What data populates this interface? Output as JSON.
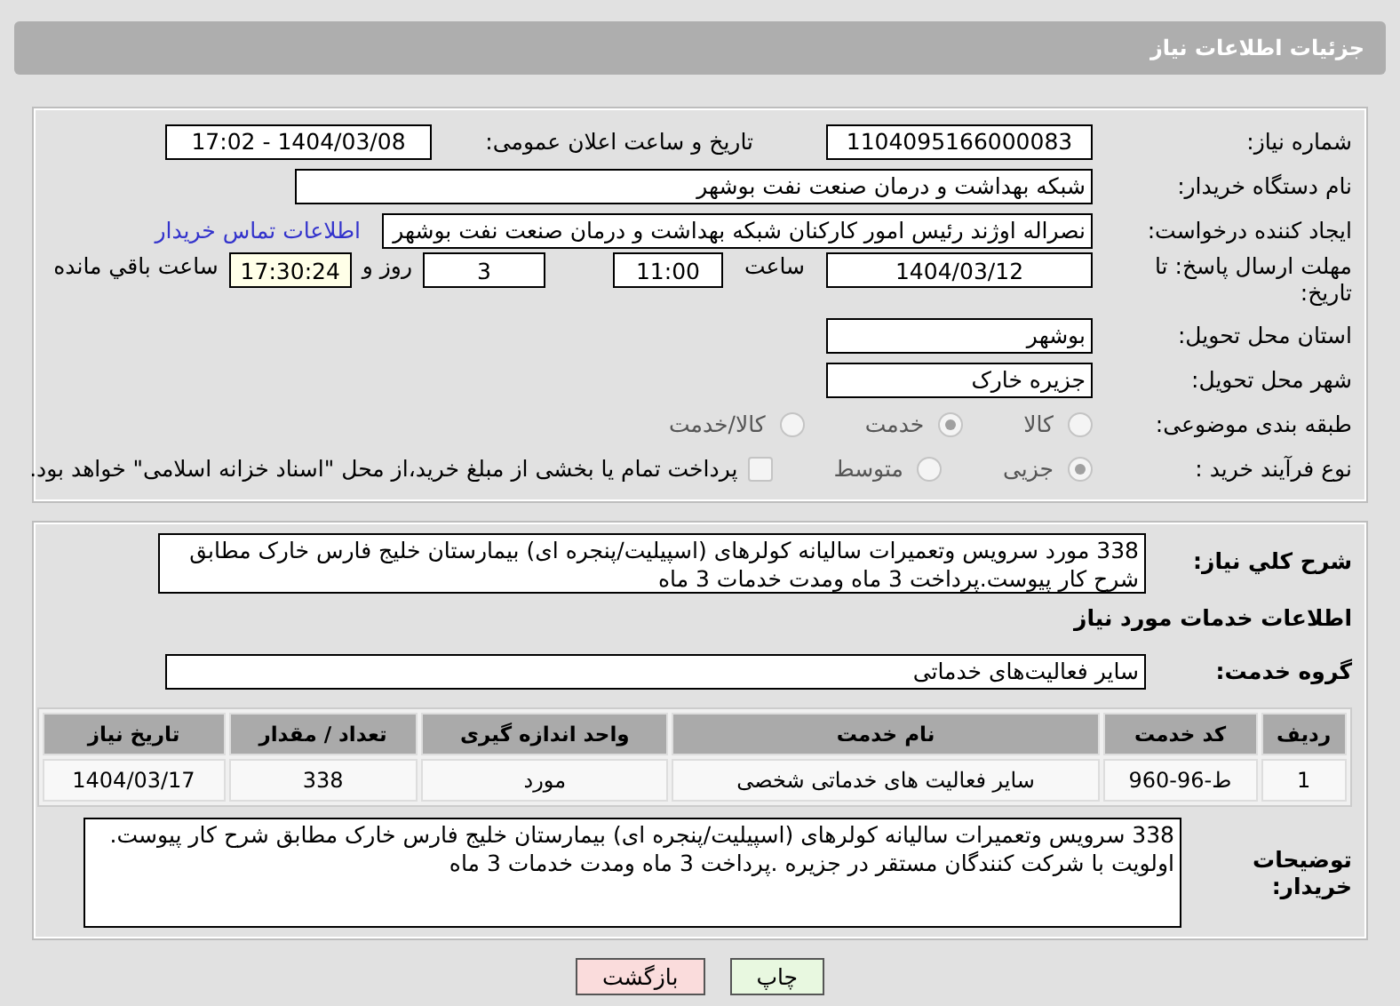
{
  "header": {
    "title": "جزئیات اطلاعات نیاز"
  },
  "need_number": {
    "label": "شماره نیاز:",
    "value": "1104095166000083"
  },
  "announce": {
    "label": "تاریخ و ساعت اعلان عمومی:",
    "value": "1404/03/08 - 17:02"
  },
  "buyer_org": {
    "label": "نام دستگاه خریدار:",
    "value": "شبکه بهداشت و درمان صنعت نفت بوشهر"
  },
  "requester": {
    "label": "ایجاد کننده درخواست:",
    "value": "نصراله اوژند رئیس امور کارکنان شبکه بهداشت و درمان صنعت نفت بوشهر",
    "link": "اطلاعات تماس خریدار"
  },
  "deadline": {
    "label": "مهلت ارسال پاسخ: تا تاریخ:",
    "date": "1404/03/12",
    "time_label": "ساعت",
    "time": "11:00",
    "days": "3",
    "days_label": "روز و",
    "remaining": "17:30:24",
    "remaining_label": "ساعت باقي مانده"
  },
  "province": {
    "label": "استان محل تحویل:",
    "value": "بوشهر"
  },
  "city": {
    "label": "شهر محل تحویل:",
    "value": "جزیره خارک"
  },
  "category": {
    "label": "طبقه بندی موضوعی:",
    "options": [
      {
        "label": "کالا",
        "selected": false
      },
      {
        "label": "خدمت",
        "selected": true
      },
      {
        "label": "کالا/خدمت",
        "selected": false
      }
    ]
  },
  "process": {
    "label": "نوع فرآیند خرید :",
    "options": [
      {
        "label": "جزیی",
        "selected": true
      },
      {
        "label": "متوسط",
        "selected": false
      }
    ],
    "payment": {
      "checked": false,
      "label": "پرداخت تمام یا بخشی از مبلغ خرید،از محل \"اسناد خزانه اسلامی\" خواهد بود."
    }
  },
  "description": {
    "label": "شرح كلي نياز:",
    "value": "338 مورد سرویس وتعمیرات سالیانه کولرهای (اسپیلیت/پنجره ای) بیمارستان خلیج فارس خارک  مطابق شرح کار پیوست.پرداخت 3 ماه ومدت خدمات 3 ماه"
  },
  "services_heading": "اطلاعات خدمات مورد نیاز",
  "service_group": {
    "label": "گروه خدمت:",
    "value": "سایر فعالیت‌های خدماتی"
  },
  "table": {
    "columns": [
      "ردیف",
      "کد خدمت",
      "نام خدمت",
      "واحد اندازه گیری",
      "تعداد / مقدار",
      "تاریخ نیاز"
    ],
    "rows": [
      [
        "1",
        "ط-96-960",
        "سایر فعالیت های خدماتی شخصی",
        "مورد",
        "338",
        "1404/03/17"
      ]
    ]
  },
  "buyer_notes": {
    "label": "توضیحات خریدار:",
    "value": "338 سرویس وتعمیرات سالیانه کولرهای (اسپیلیت/پنجره ای) بیمارستان خلیج فارس خارک مطابق شرح کار پیوست. اولویت با شرکت کنندگان مستقر در جزیره .پرداخت 3 ماه ومدت خدمات 3 ماه"
  },
  "buttons": [
    {
      "label": "چاپ",
      "kind": "print"
    },
    {
      "label": "بازگشت",
      "kind": "back"
    }
  ]
}
